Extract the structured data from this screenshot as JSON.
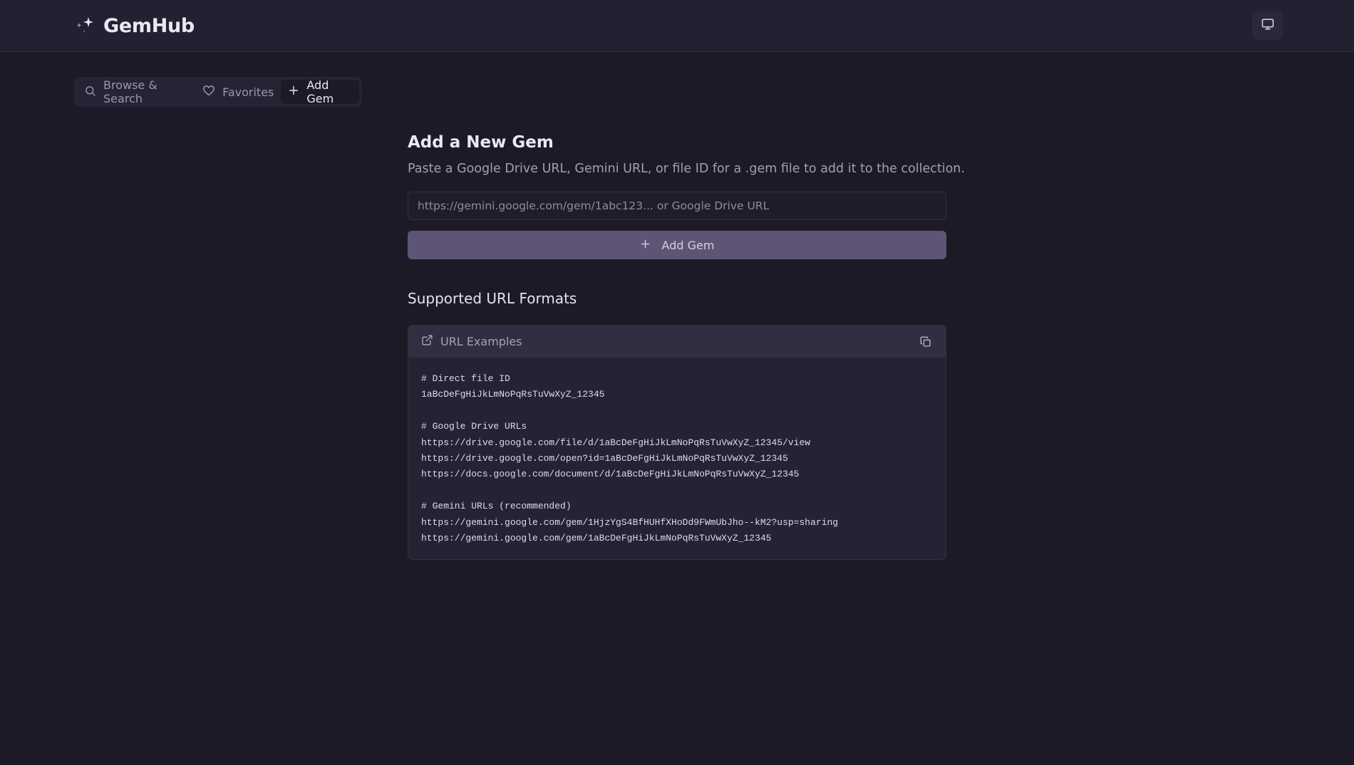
{
  "app": {
    "name": "GemHub"
  },
  "header": {
    "display_button": "monitor-icon"
  },
  "tabs": [
    {
      "label": "Browse & Search",
      "icon": "search-icon",
      "active": false
    },
    {
      "label": "Favorites",
      "icon": "heart-icon",
      "active": false
    },
    {
      "label": "Add Gem",
      "icon": "plus-icon",
      "active": true
    }
  ],
  "main": {
    "title": "Add a New Gem",
    "subtitle": "Paste a Google Drive URL, Gemini URL, or file ID for a .gem file to add it to the collection.",
    "input": {
      "value": "",
      "placeholder": "https://gemini.google.com/gem/1abc123... or Google Drive URL"
    },
    "add_button": "Add Gem",
    "formats_title": "Supported URL Formats",
    "examples": {
      "title": "URL Examples",
      "lines": [
        "# Direct file ID",
        "1aBcDeFgHiJkLmNoPqRsTuVwXyZ_12345",
        "",
        "# Google Drive URLs",
        "https://drive.google.com/file/d/1aBcDeFgHiJkLmNoPqRsTuVwXyZ_12345/view",
        "https://drive.google.com/open?id=1aBcDeFgHiJkLmNoPqRsTuVwXyZ_12345",
        "https://docs.google.com/document/d/1aBcDeFgHiJkLmNoPqRsTuVwXyZ_12345",
        "",
        "# Gemini URLs (recommended)",
        "https://gemini.google.com/gem/1HjzYgS4BfHUHfXHoDd9FWmUbJho--kM2?usp=sharing",
        "https://gemini.google.com/gem/1aBcDeFgHiJkLmNoPqRsTuVwXyZ_12345"
      ]
    }
  },
  "colors": {
    "background": "#1c1a27",
    "topbar": "#232131",
    "button": "#5e5575",
    "code_card": "#262233"
  }
}
